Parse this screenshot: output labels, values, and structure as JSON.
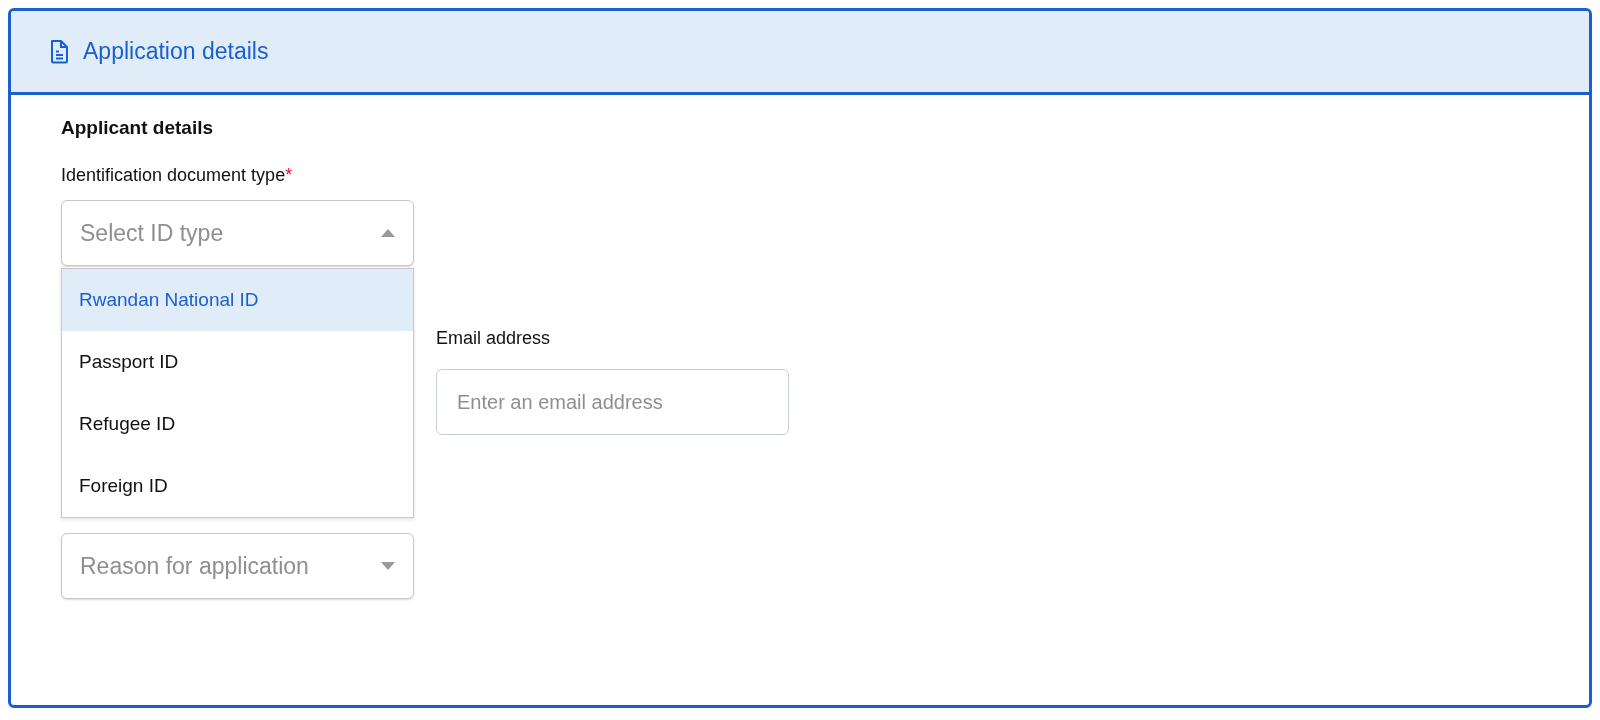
{
  "panel": {
    "title": "Application details"
  },
  "section": {
    "heading": "Applicant details"
  },
  "id_type": {
    "label": "Identification document type",
    "required_mark": "*",
    "placeholder": "Select ID type",
    "expanded": true,
    "options": [
      {
        "label": "Rwandan National ID",
        "selected": true
      },
      {
        "label": "Passport ID",
        "selected": false
      },
      {
        "label": "Refugee ID",
        "selected": false
      },
      {
        "label": "Foreign ID",
        "selected": false
      }
    ]
  },
  "email": {
    "label": "Email address",
    "placeholder": "Enter an email address"
  },
  "reason": {
    "placeholder": "Reason for application",
    "expanded": false
  }
}
